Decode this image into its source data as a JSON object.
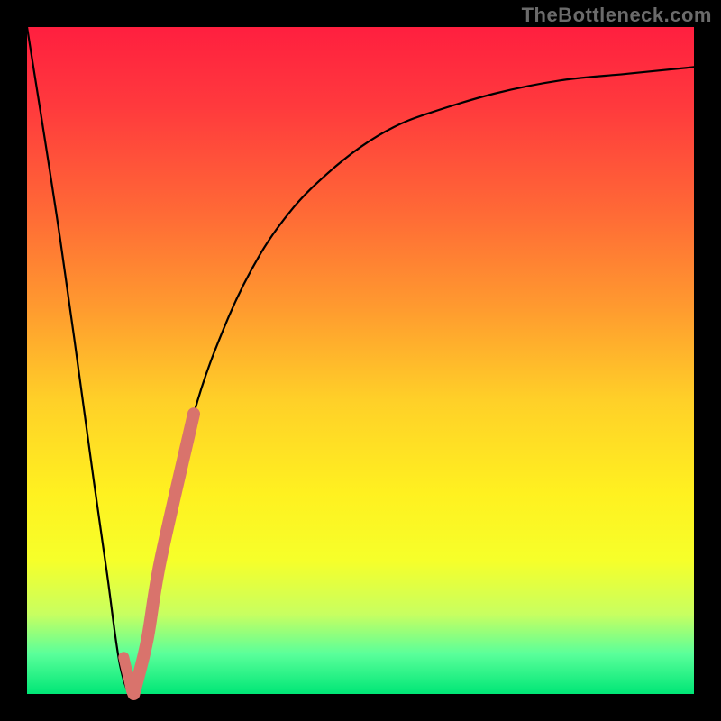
{
  "watermark": "TheBottleneck.com",
  "colors": {
    "frame": "#000000",
    "curve": "#000000",
    "overlay_stroke": "#d9736c"
  },
  "chart_data": {
    "type": "line",
    "title": "",
    "xlabel": "",
    "ylabel": "",
    "xlim": [
      0,
      100
    ],
    "ylim": [
      0,
      100
    ],
    "grid": false,
    "legend": false,
    "series": [
      {
        "name": "bottleneck-curve",
        "x": [
          0,
          5,
          10,
          12,
          14,
          16,
          18,
          20,
          25,
          30,
          35,
          40,
          45,
          50,
          55,
          60,
          70,
          80,
          90,
          100
        ],
        "y": [
          100,
          68,
          32,
          18,
          4,
          0,
          8,
          20,
          42,
          56,
          66,
          73,
          78,
          82,
          85,
          87,
          90,
          92,
          93,
          94
        ]
      }
    ],
    "annotations": [
      {
        "name": "highlight-segment",
        "on_series": "bottleneck-curve",
        "x_range": [
          16,
          25
        ],
        "note": "thick salmon highlight along curve near trough and rising branch"
      }
    ]
  }
}
